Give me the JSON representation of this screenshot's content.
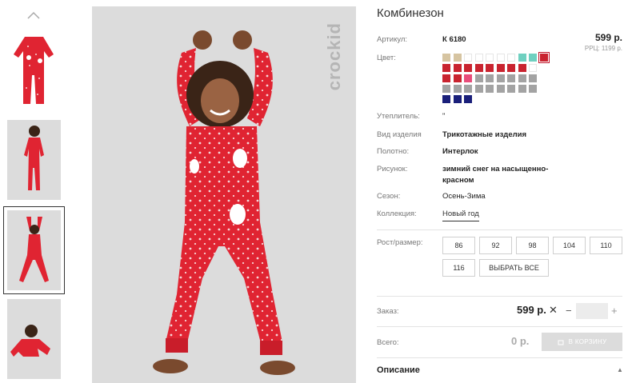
{
  "product": {
    "title": "Комбинезон",
    "price": "599 р.",
    "rrc": "РРЦ: 1199 р.",
    "brand": "crockid"
  },
  "attributes": {
    "sku_label": "Артикул:",
    "sku_value": "К 6180",
    "color_label": "Цвет:",
    "insulation_label": "Утеплитель:",
    "insulation_value": "\"",
    "type_label": "Вид изделия",
    "type_value": "Трикотажные изделия",
    "fabric_label": "Полотно:",
    "fabric_value": "Интерлок",
    "pattern_label": "Рисунок:",
    "pattern_value_1": "зимний снег на насыщенно-",
    "pattern_value_2": "красном",
    "season_label": "Сезон:",
    "season_value": "Осень-Зима",
    "collection_label": "Коллекция:",
    "collection_value": "Новый год"
  },
  "swatch_colors": [
    [
      "#d6c4a1",
      "#d6c4a1",
      "#ffffff",
      "#ffffff",
      "#ffffff",
      "#ffffff",
      "#ffffff",
      "#6fd0c0",
      "#6fd0c0",
      "#c9232f"
    ],
    [
      "#c9232f",
      "#c9232f",
      "#c9232f",
      "#c9232f",
      "#c9232f",
      "#c9232f",
      "#c9232f",
      "#c9232f",
      "#ffffff"
    ],
    [
      "#c9232f",
      "#c9232f",
      "#e84c7a",
      "#a3a3a3",
      "#a3a3a3",
      "#a3a3a3",
      "#a3a3a3",
      "#a3a3a3",
      "#a3a3a3"
    ],
    [
      "#a3a3a3",
      "#a3a3a3",
      "#a3a3a3",
      "#a3a3a3",
      "#a3a3a3",
      "#a3a3a3",
      "#a3a3a3",
      "#a3a3a3",
      "#a3a3a3"
    ],
    [
      "#1a1f7a",
      "#1a1f7a",
      "#1a1f7a"
    ]
  ],
  "sizes": {
    "label": "Рост/размер:",
    "options": [
      "86",
      "92",
      "98",
      "104",
      "110",
      "116"
    ],
    "select_all": "ВЫБРАТЬ ВСЕ"
  },
  "order": {
    "label": "Заказ:",
    "price": "599 р.",
    "remove": "✕",
    "minus": "−",
    "plus": "+",
    "quantity": ""
  },
  "total": {
    "label": "Всего:",
    "value": "0 р.",
    "cart_button": "В КОРЗИНУ"
  },
  "description": {
    "title": "Описание",
    "toggle": "▲"
  },
  "icons": {
    "thumb_up": "chevron-up-icon",
    "cart": "cart-icon"
  },
  "colors": {
    "suit_red": "#e02432",
    "dot": "#f6d4d6",
    "photo_bg": "#dcdcdc"
  }
}
